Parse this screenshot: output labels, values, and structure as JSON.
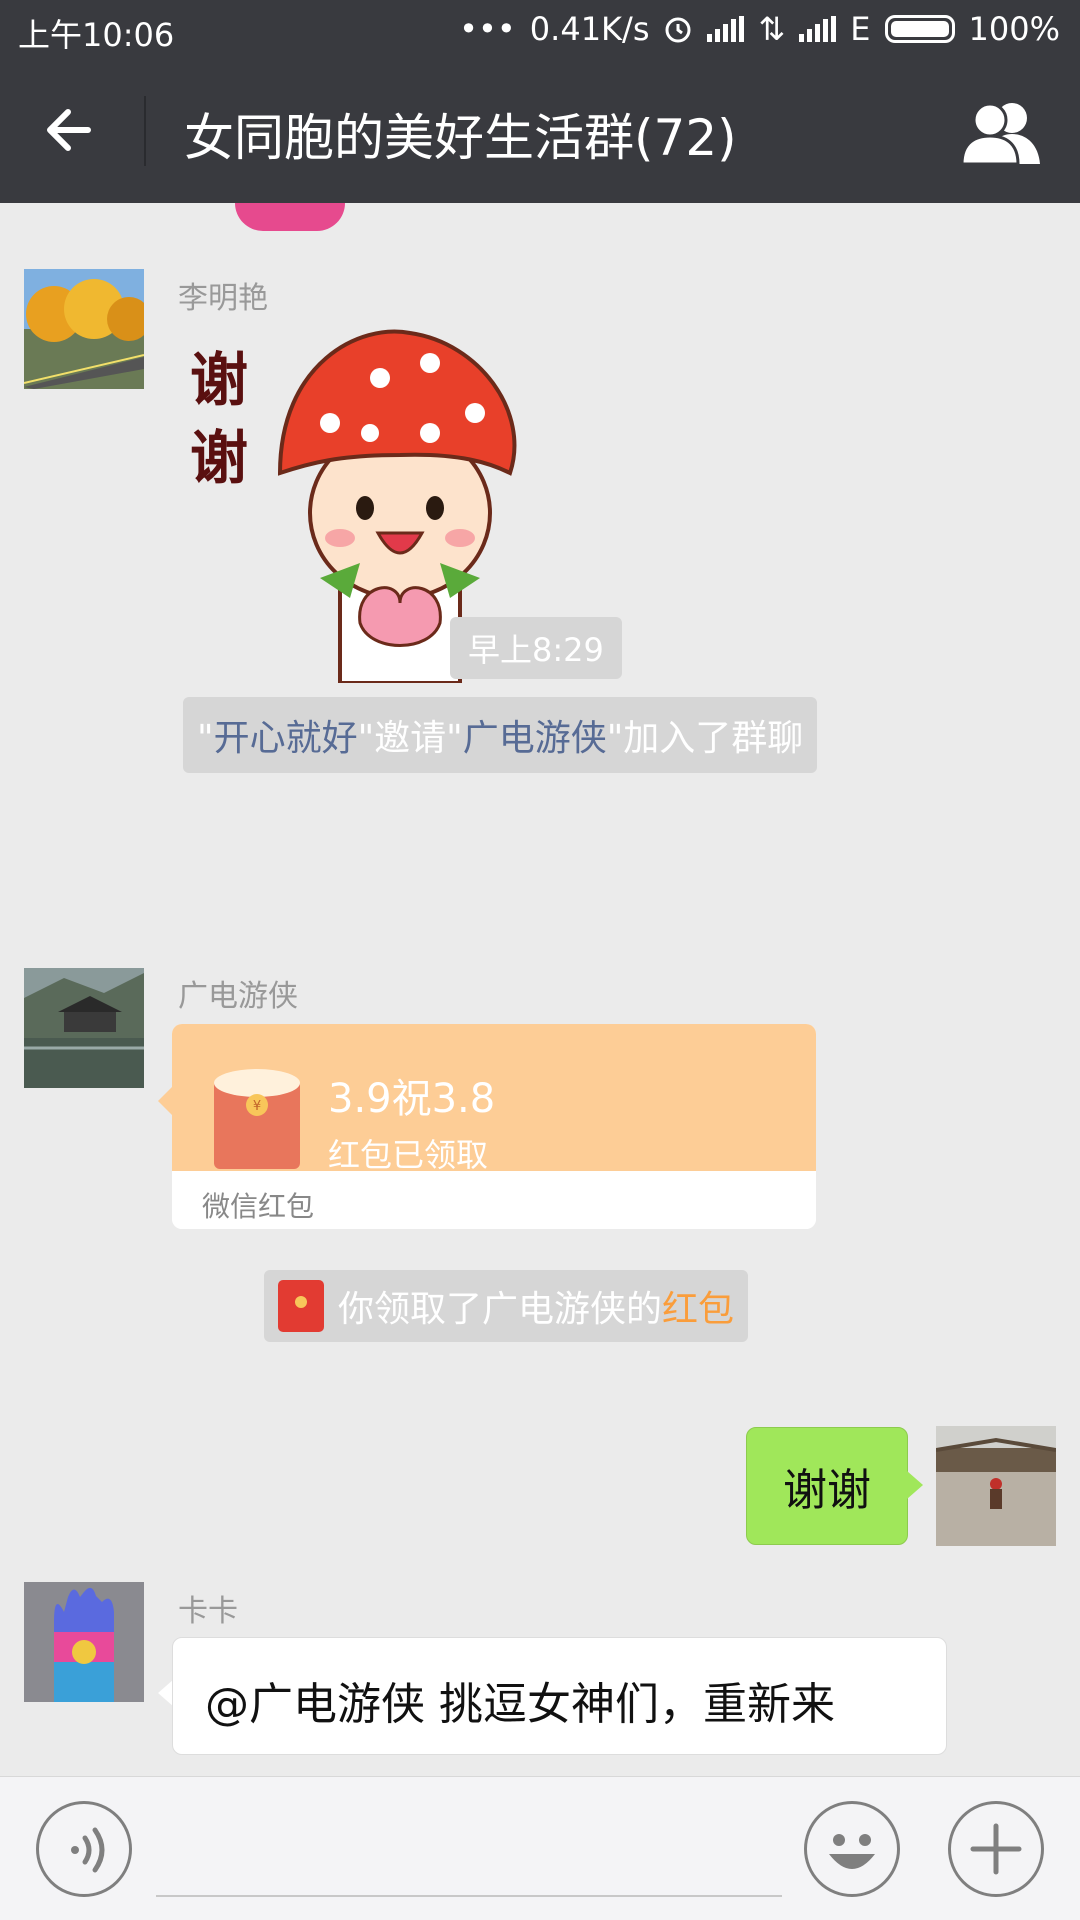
{
  "status_bar": {
    "time": "上午10:06",
    "speed": "0.41K/s",
    "network": "E",
    "battery": "100%"
  },
  "header": {
    "title": "女同胞的美好生活群(72)"
  },
  "messages": {
    "m1": {
      "sender": "李明艳",
      "sticker_text_1": "谢",
      "sticker_text_2": "谢"
    },
    "timestamp": "早上8:29",
    "system_invite": {
      "q1": "\"",
      "inviter": "开心就好",
      "q2": "\"邀请\"",
      "invitee": "广电游侠",
      "q3": "\"加入了群聊"
    },
    "m2": {
      "sender": "广电游侠",
      "packet_title": "3.9祝3.8",
      "packet_status": "红包已领取",
      "packet_footer": "微信红包"
    },
    "system_received": {
      "text": "你领取了广电游侠的",
      "link": "红包"
    },
    "m3": {
      "text": "谢谢"
    },
    "m4": {
      "sender": "卡卡",
      "text": "@广电游侠  挑逗女神们，重新来"
    }
  },
  "colors": {
    "bar_bg": "#393a3f",
    "chat_bg": "#ebebeb",
    "bubble_green": "#a0e75a",
    "red_packet": "#fdcd96",
    "link_blue": "#576b95",
    "link_orange": "#fa9d3b"
  }
}
